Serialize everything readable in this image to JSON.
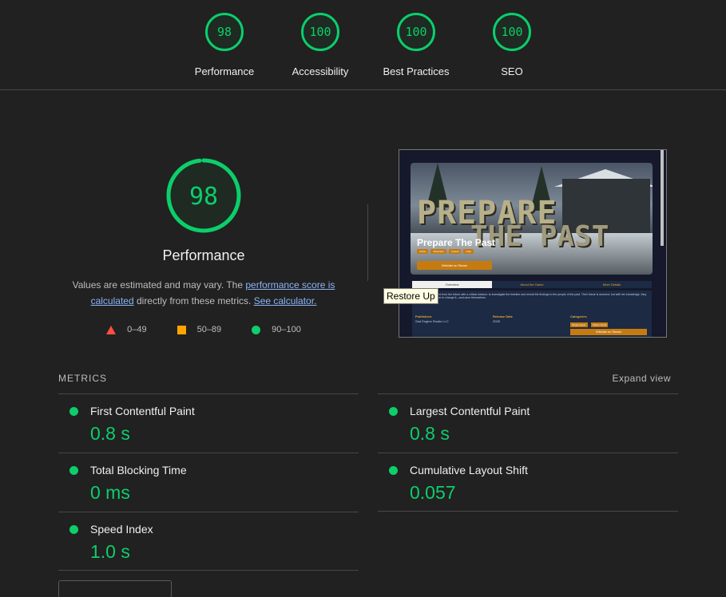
{
  "summary": [
    {
      "score": "98",
      "label": "Performance"
    },
    {
      "score": "100",
      "label": "Accessibility"
    },
    {
      "score": "100",
      "label": "Best Practices"
    },
    {
      "score": "100",
      "label": "SEO"
    }
  ],
  "performance": {
    "score": "98",
    "score_fraction": 0.98,
    "title": "Performance",
    "desc_pre": "Values are estimated and may vary. The ",
    "desc_link1": "performance score is calculated",
    "desc_mid": " directly from these metrics. ",
    "desc_link2": "See calculator.",
    "legend": [
      {
        "icon": "fail-triangle-icon",
        "range": "0–49"
      },
      {
        "icon": "average-square-icon",
        "range": "50–89"
      },
      {
        "icon": "pass-circle-icon",
        "range": "90–100"
      }
    ]
  },
  "thumbnail": {
    "logo_line1": "PREPARE",
    "logo_line2": "THE PAST",
    "game_title": "Prepare The Past",
    "tags": [
      "Action",
      "Adventure",
      "Casual",
      "Indie"
    ],
    "wishlist": "Wishlist on Steam",
    "tabs": [
      "Overview",
      "About the Game",
      "More Details"
    ],
    "description": "Sutter has been sent from the future with a critical mission: to investigate the timeline and reveal the findings to the people of the past. Their future is doomed, but with her knowledge, they might have a chance to change it—and save themselves.",
    "publisher_label": "Publishers",
    "publisher_value": "Sad Engine Studio LLC",
    "release_label": "Release Date",
    "release_value": "2025",
    "categories_label": "Categories",
    "categories": [
      "Single-player",
      "Steam Cloud"
    ],
    "wishlist2": "Wishlist on Steam"
  },
  "tooltip": "Restore Up",
  "metrics": {
    "heading": "METRICS",
    "expand": "Expand view",
    "items": [
      {
        "name": "First Contentful Paint",
        "value": "0.8 s"
      },
      {
        "name": "Largest Contentful Paint",
        "value": "0.8 s"
      },
      {
        "name": "Total Blocking Time",
        "value": "0 ms"
      },
      {
        "name": "Cumulative Layout Shift",
        "value": "0.057"
      },
      {
        "name": "Speed Index",
        "value": "1.0 s"
      }
    ]
  },
  "colors": {
    "pass": "#0cce6b",
    "average": "#ffa400",
    "fail": "#ff4e42",
    "background": "#212121",
    "link": "#8ab4f8"
  }
}
